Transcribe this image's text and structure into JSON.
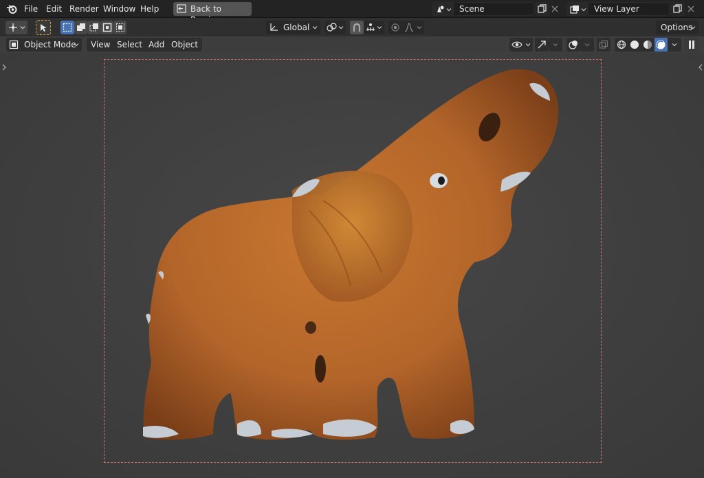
{
  "menu": {
    "items": [
      "File",
      "Edit",
      "Render",
      "Window",
      "Help"
    ],
    "back_label": "Back to Previous"
  },
  "scene": {
    "name": "Scene"
  },
  "view_layer": {
    "name": "View Layer"
  },
  "toolbar": {
    "transform_orientation": "Global",
    "options_label": "Options"
  },
  "viewport_header": {
    "mode": "Object Mode",
    "view": "View",
    "select": "Select",
    "add": "Add",
    "object": "Object"
  },
  "colors": {
    "accent_blue": "#4772b3",
    "camera_frame": "#d97070",
    "elephant_body": "#b86a2e"
  }
}
